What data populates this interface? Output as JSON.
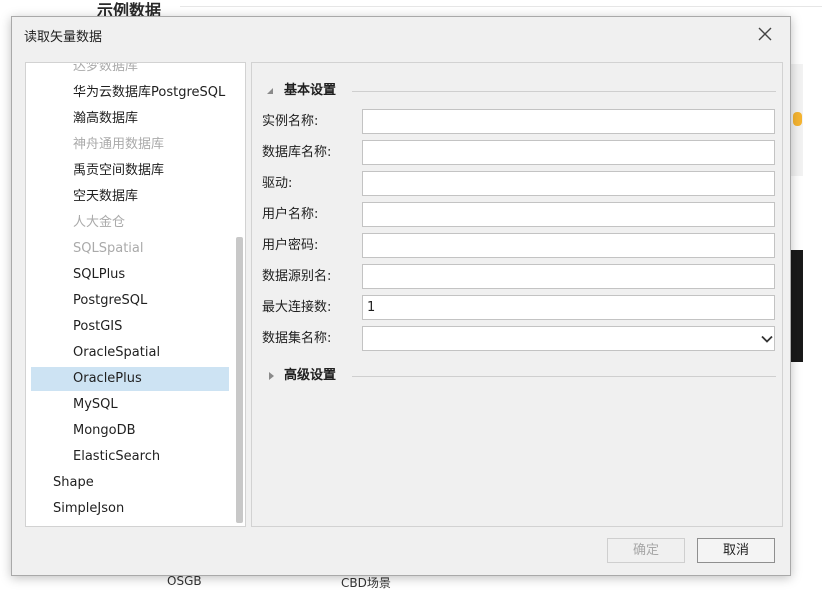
{
  "background": {
    "title": "示例数据",
    "labels": [
      "OSGB",
      "CBD场景"
    ]
  },
  "dialog": {
    "title": "读取矢量数据",
    "close_icon": "close-icon"
  },
  "tree": {
    "items": [
      {
        "label": "达梦数据库",
        "state": "disabled",
        "level": 2
      },
      {
        "label": "华为云数据库PostgreSQL",
        "state": "enabled",
        "level": 2
      },
      {
        "label": "瀚高数据库",
        "state": "enabled",
        "level": 2
      },
      {
        "label": "神舟通用数据库",
        "state": "disabled",
        "level": 2
      },
      {
        "label": "禹贡空间数据库",
        "state": "enabled",
        "level": 2
      },
      {
        "label": "空天数据库",
        "state": "enabled",
        "level": 2
      },
      {
        "label": "人大金仓",
        "state": "disabled",
        "level": 2
      },
      {
        "label": "SQLSpatial",
        "state": "disabled",
        "level": 2
      },
      {
        "label": "SQLPlus",
        "state": "enabled",
        "level": 2
      },
      {
        "label": "PostgreSQL",
        "state": "enabled",
        "level": 2
      },
      {
        "label": "PostGIS",
        "state": "enabled",
        "level": 2
      },
      {
        "label": "OracleSpatial",
        "state": "enabled",
        "level": 2
      },
      {
        "label": "OraclePlus",
        "state": "selected",
        "level": 2
      },
      {
        "label": "MySQL",
        "state": "enabled",
        "level": 2
      },
      {
        "label": "MongoDB",
        "state": "enabled",
        "level": 2
      },
      {
        "label": "ElasticSearch",
        "state": "enabled",
        "level": 2
      },
      {
        "label": "Shape",
        "state": "enabled",
        "level": 1
      },
      {
        "label": "SimpleJson",
        "state": "enabled",
        "level": 1
      }
    ]
  },
  "form": {
    "basic_section": {
      "label": "基本设置",
      "icon": "collapse-triangle-icon"
    },
    "fields": [
      {
        "label": "实例名称:",
        "value": ""
      },
      {
        "label": "数据库名称:",
        "value": ""
      },
      {
        "label": "驱动:",
        "value": ""
      },
      {
        "label": "用户名称:",
        "value": ""
      },
      {
        "label": "用户密码:",
        "value": ""
      },
      {
        "label": "数据源别名:",
        "value": ""
      },
      {
        "label": "最大连接数:",
        "value": "1"
      },
      {
        "label": "数据集名称:",
        "value": "",
        "type": "select"
      }
    ],
    "advanced_section": {
      "label": "高级设置",
      "icon": "expand-triangle-icon"
    }
  },
  "buttons": {
    "ok": "确定",
    "cancel": "取消"
  },
  "colors": {
    "selection": "#cde3f3",
    "disabled_text": "#aaaaaa",
    "dialog_bg": "#f0f0f0"
  }
}
